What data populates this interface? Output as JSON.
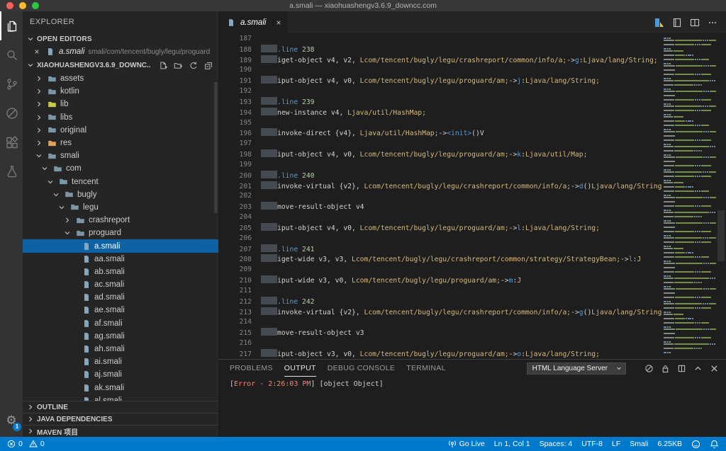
{
  "colors": {
    "accent": "#007acc",
    "selection": "#0e62a3",
    "error_text": "#f48771",
    "traffic": [
      "#ff5f57",
      "#febc2e",
      "#28c840"
    ]
  },
  "title_bar": {
    "title": "a.smali — xiaohuashengv3.6.9_downcc.com"
  },
  "activity_bar": {
    "items": [
      "files-icon",
      "search-icon",
      "source-control-icon",
      "run-debug-icon",
      "extensions-icon",
      "test-beaker-icon"
    ],
    "settings_badge": "1"
  },
  "sidebar": {
    "title": "EXPLORER",
    "open_editors": {
      "header": "OPEN EDITORS",
      "file": "a.smali",
      "path": "smali/com/tencent/bugly/legu/proguard",
      "close_glyph": "×"
    },
    "project_header": "XIAOHUASHENGV3.6.9_DOWNC...",
    "sections": [
      "OUTLINE",
      "JAVA DEPENDENCIES",
      "MAVEN 项目"
    ],
    "tree": [
      {
        "label": "assets",
        "level": 0,
        "kind": "folder",
        "state": "collapsed"
      },
      {
        "label": "kotlin",
        "level": 0,
        "kind": "folder",
        "state": "collapsed"
      },
      {
        "label": "lib",
        "level": 0,
        "kind": "folder",
        "state": "collapsed",
        "color": "#cbcb41"
      },
      {
        "label": "libs",
        "level": 0,
        "kind": "folder",
        "state": "collapsed"
      },
      {
        "label": "original",
        "level": 0,
        "kind": "folder",
        "state": "collapsed"
      },
      {
        "label": "res",
        "level": 0,
        "kind": "folder",
        "state": "collapsed",
        "color": "#dda35b"
      },
      {
        "label": "smali",
        "level": 0,
        "kind": "folder",
        "state": "expanded"
      },
      {
        "label": "com",
        "level": 1,
        "kind": "folder",
        "state": "expanded"
      },
      {
        "label": "tencent",
        "level": 2,
        "kind": "folder",
        "state": "expanded"
      },
      {
        "label": "bugly",
        "level": 3,
        "kind": "folder",
        "state": "expanded"
      },
      {
        "label": "legu",
        "level": 4,
        "kind": "folder",
        "state": "expanded"
      },
      {
        "label": "crashreport",
        "level": 5,
        "kind": "folder",
        "state": "collapsed"
      },
      {
        "label": "proguard",
        "level": 5,
        "kind": "folder",
        "state": "expanded"
      },
      {
        "label": "a.smali",
        "level": 6,
        "kind": "file",
        "selected": true
      },
      {
        "label": "aa.smali",
        "level": 6,
        "kind": "file"
      },
      {
        "label": "ab.smali",
        "level": 6,
        "kind": "file"
      },
      {
        "label": "ac.smali",
        "level": 6,
        "kind": "file"
      },
      {
        "label": "ad.smali",
        "level": 6,
        "kind": "file"
      },
      {
        "label": "ae.smali",
        "level": 6,
        "kind": "file"
      },
      {
        "label": "af.smali",
        "level": 6,
        "kind": "file"
      },
      {
        "label": "ag.smali",
        "level": 6,
        "kind": "file"
      },
      {
        "label": "ah.smali",
        "level": 6,
        "kind": "file"
      },
      {
        "label": "ai.smali",
        "level": 6,
        "kind": "file"
      },
      {
        "label": "aj.smali",
        "level": 6,
        "kind": "file"
      },
      {
        "label": "ak.smali",
        "level": 6,
        "kind": "file"
      },
      {
        "label": "al.smali",
        "level": 6,
        "kind": "file"
      }
    ]
  },
  "editor": {
    "tab": {
      "label": "a.smali",
      "close_glyph": "×"
    },
    "action_icons": [
      "preview-icon",
      "notebook-icon",
      "split-editor-icon",
      "more-actions-icon"
    ],
    "code": {
      "lines": [
        {
          "no": "187",
          "seg": []
        },
        {
          "no": "188",
          "seg": [
            [
              "d",
              ".line"
            ],
            [
              "p",
              " "
            ],
            [
              "n",
              "238"
            ]
          ]
        },
        {
          "no": "189",
          "seg": [
            [
              "p",
              "iget-object v4, v2, "
            ],
            [
              "c",
              "Lcom/tencent/bugly/legu/crashreport/common/info/a;"
            ],
            [
              "p",
              "->"
            ],
            [
              "m",
              "g"
            ],
            [
              "p",
              ":"
            ],
            [
              "c",
              "Ljava/lang/String;"
            ]
          ]
        },
        {
          "no": "190",
          "seg": []
        },
        {
          "no": "191",
          "seg": [
            [
              "p",
              "iput-object v4, v0, "
            ],
            [
              "c",
              "Lcom/tencent/bugly/legu/proguard/am;"
            ],
            [
              "p",
              "->"
            ],
            [
              "m",
              "j"
            ],
            [
              "p",
              ":"
            ],
            [
              "c",
              "Ljava/lang/String;"
            ]
          ]
        },
        {
          "no": "192",
          "seg": []
        },
        {
          "no": "193",
          "seg": [
            [
              "d",
              ".line"
            ],
            [
              "p",
              " "
            ],
            [
              "n",
              "239"
            ]
          ]
        },
        {
          "no": "194",
          "seg": [
            [
              "p",
              "new-instance v4, "
            ],
            [
              "c",
              "Ljava/util/HashMap;"
            ]
          ]
        },
        {
          "no": "195",
          "seg": []
        },
        {
          "no": "196",
          "seg": [
            [
              "p",
              "invoke-direct {v4}, "
            ],
            [
              "c",
              "Ljava/util/HashMap;"
            ],
            [
              "p",
              "->"
            ],
            [
              "m",
              "<init>"
            ],
            [
              "p",
              "()V"
            ]
          ]
        },
        {
          "no": "197",
          "seg": []
        },
        {
          "no": "198",
          "seg": [
            [
              "p",
              "iput-object v4, v0, "
            ],
            [
              "c",
              "Lcom/tencent/bugly/legu/proguard/am;"
            ],
            [
              "p",
              "->"
            ],
            [
              "m",
              "k"
            ],
            [
              "p",
              ":"
            ],
            [
              "c",
              "Ljava/util/Map;"
            ]
          ]
        },
        {
          "no": "199",
          "seg": []
        },
        {
          "no": "200",
          "seg": [
            [
              "d",
              ".line"
            ],
            [
              "p",
              " "
            ],
            [
              "n",
              "240"
            ]
          ]
        },
        {
          "no": "201",
          "seg": [
            [
              "p",
              "invoke-virtual {v2}, "
            ],
            [
              "c",
              "Lcom/tencent/bugly/legu/crashreport/common/info/a;"
            ],
            [
              "p",
              "->"
            ],
            [
              "m",
              "d"
            ],
            [
              "p",
              "()"
            ],
            [
              "c",
              "Ljava/lang/String;"
            ]
          ]
        },
        {
          "no": "202",
          "seg": []
        },
        {
          "no": "203",
          "seg": [
            [
              "p",
              "move-result-object v4"
            ]
          ]
        },
        {
          "no": "204",
          "seg": []
        },
        {
          "no": "205",
          "seg": [
            [
              "p",
              "iput-object v4, v0, "
            ],
            [
              "c",
              "Lcom/tencent/bugly/legu/proguard/am;"
            ],
            [
              "p",
              "->"
            ],
            [
              "m",
              "l"
            ],
            [
              "p",
              ":"
            ],
            [
              "c",
              "Ljava/lang/String;"
            ]
          ]
        },
        {
          "no": "206",
          "seg": []
        },
        {
          "no": "207",
          "seg": [
            [
              "d",
              ".line"
            ],
            [
              "p",
              " "
            ],
            [
              "n",
              "241"
            ]
          ]
        },
        {
          "no": "208",
          "seg": [
            [
              "p",
              "iget-wide v3, v3, "
            ],
            [
              "c",
              "Lcom/tencent/bugly/legu/crashreport/common/strategy/StrategyBean;"
            ],
            [
              "p",
              "->"
            ],
            [
              "m",
              "l"
            ],
            [
              "p",
              ":"
            ],
            [
              "c",
              "J"
            ]
          ]
        },
        {
          "no": "209",
          "seg": []
        },
        {
          "no": "210",
          "seg": [
            [
              "p",
              "iput-wide v3, v0, "
            ],
            [
              "c",
              "Lcom/tencent/bugly/legu/proguard/am;"
            ],
            [
              "p",
              "->"
            ],
            [
              "m",
              "m"
            ],
            [
              "p",
              ":"
            ],
            [
              "c",
              "J"
            ]
          ]
        },
        {
          "no": "211",
          "seg": []
        },
        {
          "no": "212",
          "seg": [
            [
              "d",
              ".line"
            ],
            [
              "p",
              " "
            ],
            [
              "n",
              "242"
            ]
          ]
        },
        {
          "no": "213",
          "seg": [
            [
              "p",
              "invoke-virtual {v2}, "
            ],
            [
              "c",
              "Lcom/tencent/bugly/legu/crashreport/common/info/a;"
            ],
            [
              "p",
              "->"
            ],
            [
              "m",
              "g"
            ],
            [
              "p",
              "()"
            ],
            [
              "c",
              "Ljava/lang/String;"
            ]
          ]
        },
        {
          "no": "214",
          "seg": []
        },
        {
          "no": "215",
          "seg": [
            [
              "p",
              "move-result-object v3"
            ]
          ]
        },
        {
          "no": "216",
          "seg": []
        },
        {
          "no": "217",
          "seg": [
            [
              "p",
              "iput-object v3, v0, "
            ],
            [
              "c",
              "Lcom/tencent/bugly/legu/proguard/am;"
            ],
            [
              "p",
              "->"
            ],
            [
              "m",
              "o"
            ],
            [
              "p",
              ":"
            ],
            [
              "c",
              "Ljava/lang/String;"
            ]
          ]
        }
      ]
    }
  },
  "panel": {
    "tabs": [
      "PROBLEMS",
      "OUTPUT",
      "DEBUG CONSOLE",
      "TERMINAL"
    ],
    "active_tab": "OUTPUT",
    "channel_select": "HTML Language Server",
    "action_icons": [
      "clear-output-icon",
      "lock-icon",
      "open-in-editor-icon",
      "maximize-panel-icon",
      "close-panel-icon"
    ],
    "output": [
      {
        "style": "plain",
        "text": "["
      },
      {
        "style": "error",
        "text": "Error - 2:26:03 PM"
      },
      {
        "style": "plain",
        "text": "] [object Object]"
      }
    ]
  },
  "status_bar": {
    "errors": "0",
    "warnings": "0",
    "go_live": "Go Live",
    "cursor": "Ln 1, Col 1",
    "spaces": "Spaces: 4",
    "encoding": "UTF-8",
    "eol": "LF",
    "language": "Smali",
    "file_size": "6.25KB"
  }
}
